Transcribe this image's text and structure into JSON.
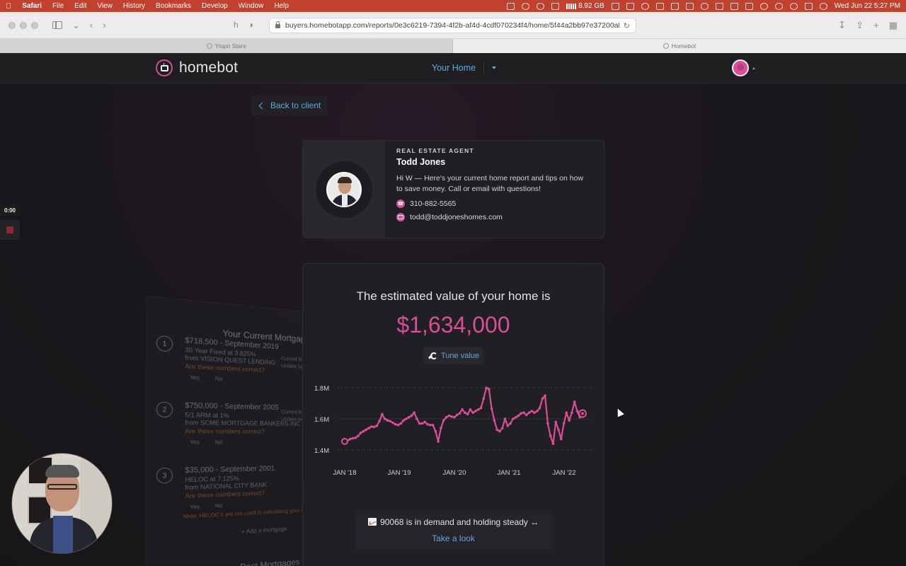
{
  "menubar": {
    "app": "Safari",
    "items": [
      "File",
      "Edit",
      "View",
      "History",
      "Bookmarks",
      "Develop",
      "Window",
      "Help"
    ],
    "memory": "8.92 GB",
    "clock": "Wed Jun 22  5:27 PM"
  },
  "browser": {
    "url": "buyers.homebotapp.com/reports/0e3c6219-7394-4f2b-af4d-4cdf070234f4/home/5f44a2bb97e37200ab5",
    "tabs": [
      {
        "label": "Ylopo Stars",
        "active": false
      },
      {
        "label": "Homebot",
        "active": true
      }
    ]
  },
  "nav": {
    "logo": "homebot",
    "center_link": "Your Home"
  },
  "back_button": "Back to client",
  "recorder": {
    "time": "0:00"
  },
  "agent": {
    "role": "REAL ESTATE AGENT",
    "name": "Todd Jones",
    "message": "Hi W — Here's your current home report and tips on how to save money. Call or email with questions!",
    "phone": "310-882-5565",
    "email": "todd@toddjoneshomes.com"
  },
  "mortgages": {
    "title": "Your Current Mortgages",
    "items": [
      {
        "num": "1",
        "amount": "$718,500 - September 2019",
        "type": "30 Year Fixed at 3.625%",
        "lender": "from VISION QUEST LENDING",
        "question": "Are these numbers correct?",
        "side": "Current B",
        "side2": "Update ba"
      },
      {
        "num": "2",
        "amount": "$750,000 - September 2005",
        "type": "5/1 ARM at 1%",
        "lender": "from SCME MORTGAGE BANKERS INC",
        "question": "Are these numbers correct?",
        "side": "Current B",
        "side2": "Update ba"
      },
      {
        "num": "3",
        "amount": "$35,000 - September 2001",
        "type": "HELOC at 7.125%",
        "lender": "from NATIONAL CITY BANK",
        "question": "Are these numbers correct?",
        "side": "",
        "side2": ""
      }
    ],
    "yes": "Yes",
    "no": "No",
    "note": "Note: HELOC's are not used in calculating your m",
    "add": "Add a mortgage",
    "past": "Past Mortgages"
  },
  "value": {
    "heading": "The estimated value of your home is",
    "amount": "$1,634,000",
    "tune": "Tune value"
  },
  "chart_data": {
    "type": "line",
    "y_ticks": [
      "1.8M",
      "1.6M",
      "1.4M"
    ],
    "ylim": [
      1.4,
      1.8
    ],
    "x_ticks": [
      "JAN '18",
      "JAN '19",
      "JAN '20",
      "JAN '21",
      "JAN '22"
    ],
    "series": [
      {
        "values": [
          1.455,
          1.46,
          1.47,
          1.475,
          1.478,
          1.49,
          1.51,
          1.52,
          1.53,
          1.54,
          1.55,
          1.548,
          1.555,
          1.585,
          1.63,
          1.6,
          1.59,
          1.585,
          1.575,
          1.565,
          1.56,
          1.57,
          1.59,
          1.6,
          1.61,
          1.62,
          1.64,
          1.6,
          1.57,
          1.57,
          1.58,
          1.565,
          1.56,
          1.56,
          1.52,
          1.455,
          1.54,
          1.59,
          1.61,
          1.62,
          1.615,
          1.61,
          1.625,
          1.635,
          1.66,
          1.64,
          1.63,
          1.66,
          1.64,
          1.65,
          1.66,
          1.67,
          1.73,
          1.8,
          1.79,
          1.665,
          1.59,
          1.53,
          1.52,
          1.54,
          1.6,
          1.555,
          1.57,
          1.6,
          1.61,
          1.62,
          1.635,
          1.64,
          1.625,
          1.64,
          1.65,
          1.64,
          1.65,
          1.67,
          1.73,
          1.75,
          1.57,
          1.49,
          1.44,
          1.58,
          1.53,
          1.47,
          1.57,
          1.64,
          1.59,
          1.64,
          1.71,
          1.65,
          1.61,
          1.634
        ],
        "color": "#d94d99"
      }
    ],
    "grid": true
  },
  "demand": {
    "text": "90068 is in demand and holding steady",
    "link": "Take a look"
  },
  "colors": {
    "accent": "#d94d99",
    "link": "#5fa9e0",
    "menubar": "#c2402e"
  }
}
